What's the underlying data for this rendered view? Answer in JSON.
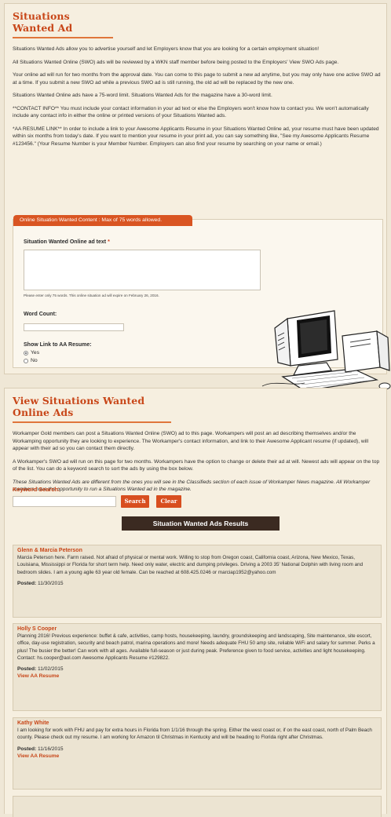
{
  "swo_section": {
    "title": "Situations Wanted Ad",
    "paragraphs": [
      "Situations Wanted Ads allow you to advertise yourself and let Employers know that you are looking for a certain employment situation!",
      "All Situations Wanted Online (SWO) ads will be reviewed by a WKN staff member before being posted to the Employers' View SWO Ads page.",
      "Your online ad will run for two months from the approval date. You can come to this page to submit a new ad anytime, but you may only have one active SWO ad at a time. If you submit a new SWO ad while a previous SWO ad is still running, the old ad will be replaced by the new one.",
      "Situations Wanted Online ads have a 75-word limit. Situations Wanted Ads for the magazine have a 30-word limit.",
      "**CONTACT INFO** You must include your contact information in your ad text or else the Employers won't know how to contact you. We won't automatically include any contact info in either the online or printed versions of your Situations Wanted ads.",
      "*AA RESUME LINK** In order to include a link to your Awesome Applicants Resume in your Situations Wanted Online ad, your resume must have been updated within six months from today's date. If you want to mention your resume in your print ad, you can say something like, \"See my Awesome Applicants Resume #123456.\" (Your Resume Number is your Member Number. Employers can also find your resume by searching on your name or email.)"
    ],
    "form": {
      "tab_label": "Online Situation Wanted Content : Max of 75 words allowed.",
      "ad_text_label": "Situation Wanted Online ad text",
      "required_mark": "*",
      "ad_text_value": "",
      "hint": "Please enter only 75 words. This online situation ad will expire on February 26, 2016.",
      "word_count_label": "Word Count:",
      "word_count_value": "",
      "resume_link_label": "Show Link to AA Resume:",
      "option_yes": "Yes",
      "option_no": "No",
      "selected": "Yes"
    }
  },
  "view_section": {
    "title": "View Situations Wanted Online Ads",
    "paragraphs": [
      "Workamper Gold members can post a Situations Wanted Online (SWO) ad to this page. Workampers will post an ad describing themselves and/or the Workamping opportunity they are looking to experience. The Workamper's contact information, and link to their Awesome Applicant resume (if updated), will appear with their ad so you can contact them directly.",
      "A Workamper's SWO ad will run on this page for two months. Workampers have the option to change or delete their ad at will. Newest ads will appear on the top of the list. You can do a keyword search to sort the ads by using the box below."
    ],
    "italic_note": "These Situations Wanted Ads are different from the ones you will see in the Classifieds section of each issue of Workamper News magazine. All Workamper members have the opportunity to run a Situations Wanted ad in the magazine.",
    "keyword_label": "Keyword Search:",
    "keyword_value": "",
    "search_button": "Search",
    "clear_button": "Clear",
    "results_title": "Situation Wanted Ads Results",
    "posted_label": "Posted:",
    "view_resume_label": "View AA Resume",
    "ads": [
      {
        "name": "Glenn & Marcia Peterson",
        "text": "Marcia Peterson here. Farm raised. Not afraid of physical or mental work. Willing to stop from Oregon coast, California coast, Arizona, New Mexico, Texas, Louisiana, Mississippi or Florida for short term help. Need only water, electric and dumping privileges. Driving a 2003 35' National Dolphin with living room and bedroom slides. I am a young agile 63 year old female. Can be reached at 608.425.0246 or marciap1952@yahoo.com",
        "posted": "11/30/2015"
      },
      {
        "name": "Holly S Cooper",
        "text": "Planning 2016! Previous experience: buffet & cafe, activities, camp hosts, housekeeping, laundry, groundskeeping and landscaping, Site maintenance, site escort, office, day-use registration, security and beach patrol, marina operations and more! Needs adequate FHU 50 amp site, reliable WiFi and salary for summer. Perks a plus! The busier the better! Can work with all ages. Available full-season or just during peak. Preference given to food service, activities and light housekeeping. Contact: hs.cooper@aol.com Awesome Applicants Resume #129822.",
        "posted": "11/02/2015"
      },
      {
        "name": "Kathy White",
        "text": "I am looking for work with FHU and pay for extra hours in Florida from 1/1/16 through the spring. Either the west coast or, if on the east coast, north of Palm Beach county. Please check out my resume. I am working for Amazon til Christmas in Kentucky and will be heading to Florida right after Christmas.",
        "posted": "11/16/2015"
      }
    ]
  }
}
